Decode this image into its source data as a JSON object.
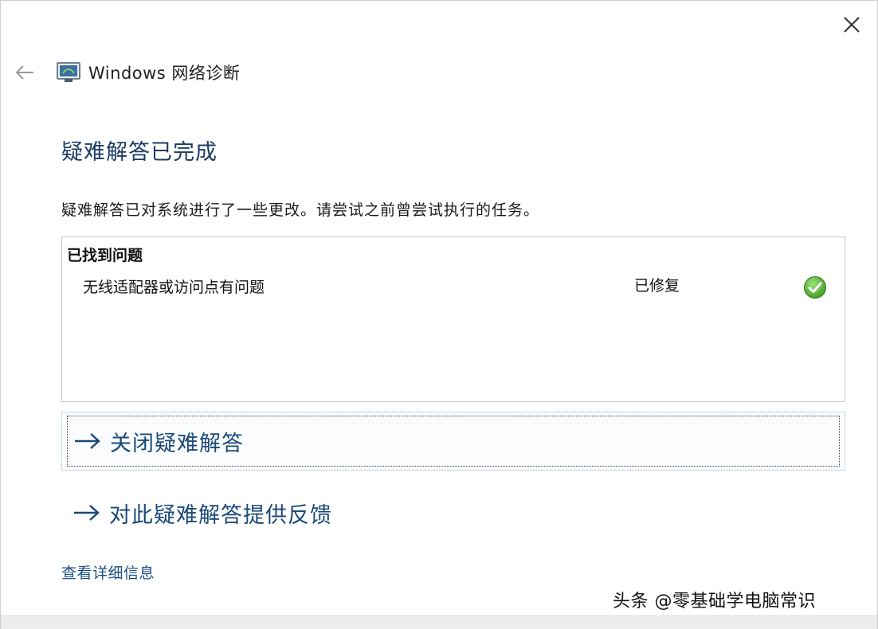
{
  "window": {
    "app_title": "Windows 网络诊断",
    "close_icon": "close-icon",
    "back_icon": "back-arrow-icon",
    "app_icon": "network-diagnostics-icon"
  },
  "main": {
    "title": "疑难解答已完成",
    "description": "疑难解答已对系统进行了一些更改。请尝试之前曾尝试执行的任务。"
  },
  "problems": {
    "header": "已找到问题",
    "items": [
      {
        "name": "无线适配器或访问点有问题",
        "status": "已修复",
        "status_icon": "check-circle-icon",
        "status_color": "#4caf2f"
      }
    ]
  },
  "actions": {
    "close_label": "关闭疑难解答",
    "feedback_label": "对此疑难解答提供反馈",
    "arrow_icon": "arrow-right-icon",
    "accent_color": "#1c4a78"
  },
  "details_link": "查看详细信息",
  "watermark": "头条 @零基础学电脑常识"
}
